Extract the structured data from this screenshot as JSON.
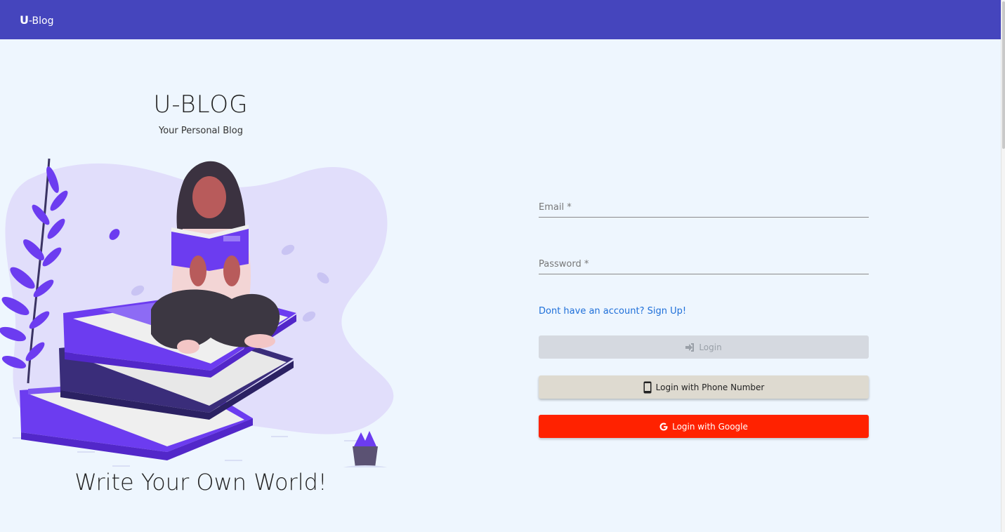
{
  "appbar": {
    "logo_u": "U",
    "logo_rest": "-Blog"
  },
  "hero": {
    "title": "U-BLOG",
    "subtitle": "Your Personal Blog",
    "tagline": "Write Your Own World!"
  },
  "form": {
    "email_label": "Email *",
    "password_label": "Password *",
    "signup_link": "Dont have an account? Sign Up!",
    "login_button": "Login",
    "phone_button": "Login with Phone Number",
    "google_button": "Login with Google"
  },
  "icons": {
    "login": "sign-in-icon",
    "phone": "mobile-phone-icon",
    "google": "google-g-icon"
  },
  "colors": {
    "appbar": "#4545bd",
    "background": "#eef6fe",
    "accent_purple": "#6c3cf0",
    "google_red": "#ff2200",
    "link_blue": "#1e6fd9"
  }
}
